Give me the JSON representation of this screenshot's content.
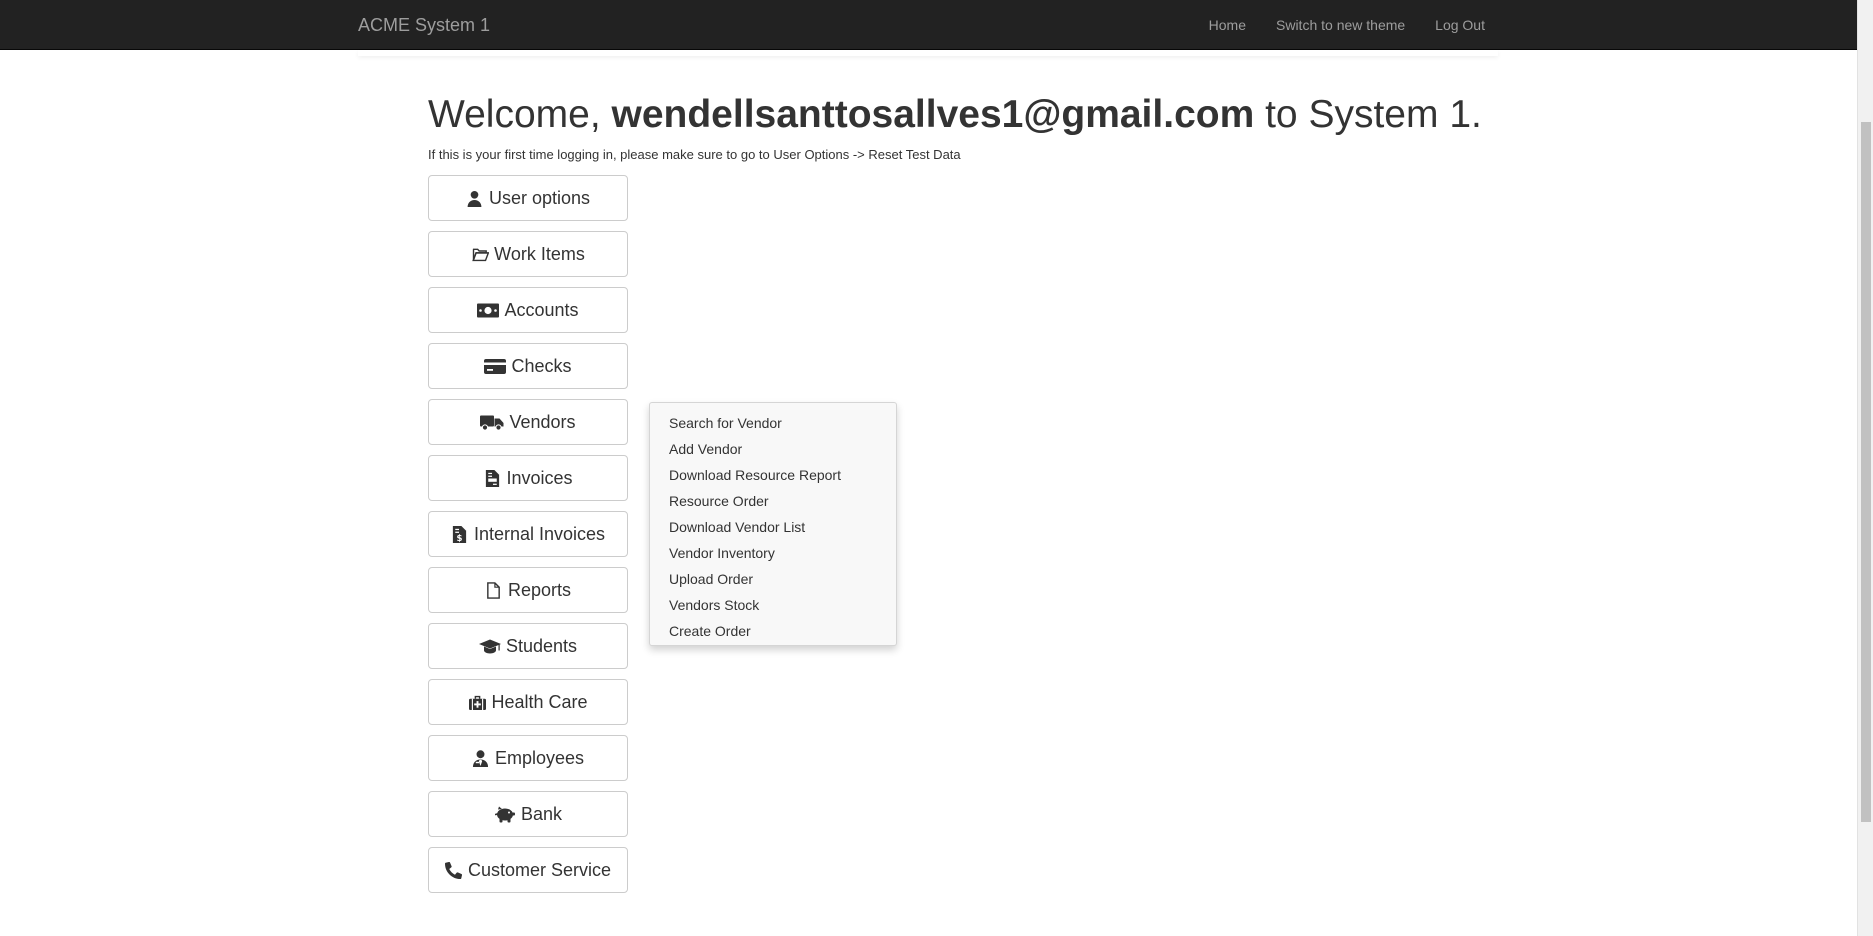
{
  "navbar": {
    "brand": "ACME System 1",
    "links": [
      "Home",
      "Switch to new theme",
      "Log Out"
    ]
  },
  "welcome": {
    "prefix": "Welcome, ",
    "email": "wendellsanttosallves1@gmail.com",
    "suffix": " to System 1."
  },
  "hint": "If this is your first time logging in, please make sure to go to User Options -> Reset Test Data",
  "menu": [
    {
      "label": "User options",
      "icon": "user-icon"
    },
    {
      "label": "Work Items",
      "icon": "folder-open-icon"
    },
    {
      "label": "Accounts",
      "icon": "money-bill-icon"
    },
    {
      "label": "Checks",
      "icon": "credit-card-icon"
    },
    {
      "label": "Vendors",
      "icon": "truck-icon"
    },
    {
      "label": "Invoices",
      "icon": "file-invoice-icon"
    },
    {
      "label": "Internal Invoices",
      "icon": "file-invoice-dollar-icon"
    },
    {
      "label": "Reports",
      "icon": "file-icon"
    },
    {
      "label": "Students",
      "icon": "graduation-cap-icon"
    },
    {
      "label": "Health Care",
      "icon": "medkit-icon"
    },
    {
      "label": "Employees",
      "icon": "user-tie-icon"
    },
    {
      "label": "Bank",
      "icon": "piggy-bank-icon"
    },
    {
      "label": "Customer Service",
      "icon": "phone-icon"
    }
  ],
  "vendors_dropdown": [
    "Search for Vendor",
    "Add Vendor",
    "Download Resource Report",
    "Resource Order",
    "Download Vendor List",
    "Vendor Inventory",
    "Upload Order",
    "Vendors Stock",
    "Create Order"
  ]
}
